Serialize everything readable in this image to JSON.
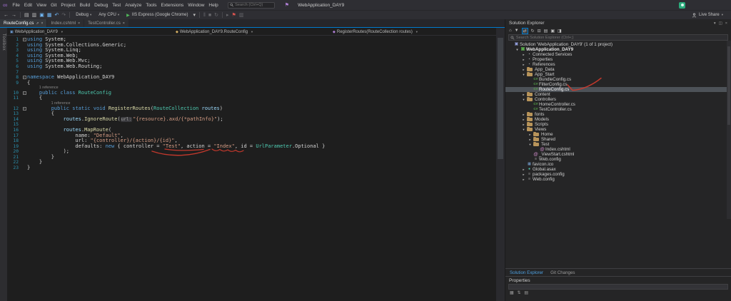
{
  "colors": {
    "accent_blue": "#007acc",
    "editor_bg": "#1e1e1e",
    "chrome_bg": "#2e2e33",
    "red_pen": "#d23b2e",
    "selection": "#4d5258"
  },
  "toolbox_label": "Toolbox",
  "title_bar": {
    "menus": [
      "File",
      "Edit",
      "View",
      "Git",
      "Project",
      "Build",
      "Debug",
      "Test",
      "Analyze",
      "Tools",
      "Extensions",
      "Window",
      "Help"
    ],
    "search": {
      "placeholder": "Search (Ctrl+Q)"
    },
    "window_title": "WebApplication_DAY9"
  },
  "toolbar": {
    "items": [
      {
        "type": "icon",
        "name": "back-icon",
        "glyph": "←"
      },
      {
        "type": "icon",
        "name": "forward-icon",
        "glyph": "→"
      },
      {
        "type": "sep"
      },
      {
        "type": "icon",
        "name": "new-file-icon",
        "glyph": "▤"
      },
      {
        "type": "icon",
        "name": "open-file-icon",
        "glyph": "▥"
      },
      {
        "type": "icon",
        "name": "save-icon",
        "glyph": "▣",
        "color": "#75beff"
      },
      {
        "type": "icon",
        "name": "save-all-icon",
        "glyph": "▦",
        "color": "#75beff"
      },
      {
        "type": "icon",
        "name": "undo-icon",
        "glyph": "↶",
        "color": "#75beff"
      },
      {
        "type": "icon",
        "name": "redo-icon",
        "glyph": "↷",
        "dim": true
      },
      {
        "type": "sep"
      },
      {
        "type": "dropdown",
        "name": "configuration-dropdown",
        "label": "Debug"
      },
      {
        "type": "dropdown",
        "name": "platform-dropdown",
        "label": "Any CPU"
      },
      {
        "type": "run",
        "name": "start-debug-button",
        "label": "IIS Express (Google Chrome)"
      },
      {
        "type": "icon",
        "name": "run-options-chevron-icon",
        "glyph": "▾"
      },
      {
        "type": "sep"
      },
      {
        "type": "icon",
        "name": "pause-icon",
        "glyph": "‖",
        "dim": true
      },
      {
        "type": "icon",
        "name": "stop-icon",
        "glyph": "■",
        "dim": true
      },
      {
        "type": "icon",
        "name": "restart-icon",
        "glyph": "↻",
        "dim": true
      },
      {
        "type": "sep"
      },
      {
        "type": "icon",
        "name": "find-in-files-icon",
        "glyph": "▸",
        "dim": true
      },
      {
        "type": "icon",
        "name": "feedback-flag-icon",
        "glyph": "⚑",
        "color": "#d9534f"
      },
      {
        "type": "icon",
        "name": "chart-icon",
        "glyph": "▥",
        "dim": true
      }
    ],
    "live_share": {
      "label": "Live Share"
    }
  },
  "tabs": [
    {
      "label": "RouteConfig.cs",
      "active": true
    },
    {
      "label": "Index.cshtml",
      "active": false
    },
    {
      "label": "TestController.cs",
      "active": false
    }
  ],
  "breadcrumb": {
    "segments": [
      {
        "label": "WebApplication_DAY9"
      },
      {
        "label": "WebApplication_DAY9.RouteConfig"
      },
      {
        "label": "RegisterRoutes(RouteCollection routes)"
      }
    ]
  },
  "editor": {
    "lines": [
      {
        "n": 1,
        "fold": true,
        "tokens": [
          [
            "k",
            "using"
          ],
          [
            "pl",
            " System;"
          ]
        ]
      },
      {
        "n": 2,
        "tokens": [
          [
            "k",
            "using"
          ],
          [
            "pl",
            " System.Collections.Generic;"
          ]
        ]
      },
      {
        "n": 3,
        "tokens": [
          [
            "k",
            "using"
          ],
          [
            "pl",
            " System.Linq;"
          ]
        ]
      },
      {
        "n": 4,
        "tokens": [
          [
            "k",
            "using"
          ],
          [
            "pl",
            " System.Web;"
          ]
        ]
      },
      {
        "n": 5,
        "tokens": [
          [
            "k",
            "using"
          ],
          [
            "pl",
            " System.Web.Mvc;"
          ]
        ]
      },
      {
        "n": 6,
        "tokens": [
          [
            "k",
            "using"
          ],
          [
            "pl",
            " System.Web.Routing;"
          ]
        ]
      },
      {
        "n": 7,
        "tokens": []
      },
      {
        "n": 8,
        "fold": true,
        "tokens": [
          [
            "k",
            "namespace"
          ],
          [
            "pl",
            " WebApplication_DAY9"
          ]
        ]
      },
      {
        "n": 9,
        "tokens": [
          [
            "pl",
            "{"
          ]
        ]
      },
      {
        "n": 10,
        "fold": true,
        "codelens": "1 reference",
        "codelens_indent": 4,
        "tokens": [
          [
            "pl",
            "    "
          ],
          [
            "k",
            "public"
          ],
          [
            "pl",
            " "
          ],
          [
            "k",
            "class"
          ],
          [
            "ty",
            " RouteConfig"
          ]
        ]
      },
      {
        "n": 11,
        "tokens": [
          [
            "pl",
            "    {"
          ]
        ]
      },
      {
        "n": 12,
        "fold": true,
        "codelens": "1 reference",
        "codelens_indent": 8,
        "tokens": [
          [
            "pl",
            "        "
          ],
          [
            "k",
            "public"
          ],
          [
            "pl",
            " "
          ],
          [
            "k",
            "static"
          ],
          [
            "pl",
            " "
          ],
          [
            "k",
            "void"
          ],
          [
            "me",
            " RegisterRoutes"
          ],
          [
            "pl",
            "("
          ],
          [
            "ty",
            "RouteCollection"
          ],
          [
            "va",
            " routes"
          ],
          [
            "pl",
            ")"
          ]
        ]
      },
      {
        "n": 13,
        "tokens": [
          [
            "pl",
            "        {"
          ]
        ]
      },
      {
        "n": 14,
        "tokens": [
          [
            "pl",
            "            "
          ],
          [
            "va",
            "routes"
          ],
          [
            "pl",
            "."
          ],
          [
            "me",
            "IgnoreRoute"
          ],
          [
            "pl",
            "("
          ],
          [
            "hint",
            "url:"
          ],
          [
            "st",
            "\"{resource}.axd/{*pathInfo}\""
          ],
          [
            "pl",
            ");"
          ]
        ]
      },
      {
        "n": 15,
        "tokens": []
      },
      {
        "n": 16,
        "tokens": [
          [
            "pl",
            "            "
          ],
          [
            "va",
            "routes"
          ],
          [
            "pl",
            "."
          ],
          [
            "me",
            "MapRoute"
          ],
          [
            "pl",
            "("
          ]
        ]
      },
      {
        "n": 17,
        "tokens": [
          [
            "pl",
            "                name: "
          ],
          [
            "st",
            "\"Default\""
          ],
          [
            "pl",
            ","
          ]
        ]
      },
      {
        "n": 18,
        "tokens": [
          [
            "pl",
            "                url: "
          ],
          [
            "st",
            "\"{controller}/{action}/{id}\""
          ],
          [
            "pl",
            ","
          ]
        ]
      },
      {
        "n": 19,
        "tokens": [
          [
            "pl",
            "                defaults: "
          ],
          [
            "k",
            "new"
          ],
          [
            "pl",
            " { controller = "
          ],
          [
            "st",
            "\"Test\""
          ],
          [
            "pl",
            ", action = "
          ],
          [
            "st",
            "\"Index\""
          ],
          [
            "pl",
            ", id = "
          ],
          [
            "ty",
            "UrlParameter"
          ],
          [
            "pl",
            ".Optional }"
          ]
        ]
      },
      {
        "n": 20,
        "tokens": [
          [
            "pl",
            "            );"
          ]
        ]
      },
      {
        "n": 21,
        "tokens": [
          [
            "pl",
            "        }"
          ]
        ]
      },
      {
        "n": 22,
        "tokens": [
          [
            "pl",
            "    }"
          ]
        ]
      },
      {
        "n": 23,
        "tokens": [
          [
            "pl",
            "}"
          ]
        ]
      }
    ]
  },
  "solution_explorer": {
    "title": "Solution Explorer",
    "header_icons": [
      {
        "name": "chevron-down-icon",
        "glyph": "▾"
      },
      {
        "name": "maximize-icon",
        "glyph": "◫"
      },
      {
        "name": "close-icon",
        "glyph": "×"
      }
    ],
    "toolbar_icons": [
      {
        "name": "home-icon",
        "glyph": "⌂"
      },
      {
        "name": "filter-icon",
        "glyph": "▼"
      },
      {
        "name": "sync-active-document-icon",
        "glyph": "⇄",
        "boxed": true
      },
      {
        "name": "refresh-icon",
        "glyph": "↻"
      },
      {
        "name": "collapse-all-icon",
        "glyph": "⊟"
      },
      {
        "name": "show-all-files-icon",
        "glyph": "▤"
      },
      {
        "name": "properties-icon",
        "glyph": "▣"
      },
      {
        "name": "preview-icon",
        "glyph": "◨"
      }
    ],
    "search": {
      "placeholder": "Search Solution Explorer (Ctrl+;)"
    },
    "tree": [
      {
        "indent": 0,
        "arrow": "",
        "icon": "solution",
        "label": "Solution 'WebApplication_DAY9' (1 of 1 project)"
      },
      {
        "indent": 1,
        "arrow": "down",
        "icon": "project",
        "label": "WebApplication_DAY9",
        "bold": true
      },
      {
        "indent": 2,
        "arrow": "right",
        "icon": "generic",
        "label": "Connected Services"
      },
      {
        "indent": 2,
        "arrow": "right",
        "icon": "generic",
        "label": "Properties"
      },
      {
        "indent": 2,
        "arrow": "right",
        "icon": "generic",
        "label": "References"
      },
      {
        "indent": 2,
        "arrow": "right",
        "icon": "folder",
        "label": "App_Data"
      },
      {
        "indent": 2,
        "arrow": "down",
        "icon": "folder",
        "label": "App_Start"
      },
      {
        "indent": 3,
        "arrow": "",
        "icon": "cs",
        "label": "BundleConfig.cs"
      },
      {
        "indent": 3,
        "arrow": "",
        "icon": "cs",
        "label": "FilterConfig.cs"
      },
      {
        "indent": 3,
        "arrow": "",
        "icon": "cs",
        "label": "RouteConfig.cs",
        "selected": true
      },
      {
        "indent": 2,
        "arrow": "right",
        "icon": "folder",
        "label": "Content"
      },
      {
        "indent": 2,
        "arrow": "down",
        "icon": "folder",
        "label": "Controllers"
      },
      {
        "indent": 3,
        "arrow": "",
        "icon": "cs",
        "label": "HomeController.cs"
      },
      {
        "indent": 3,
        "arrow": "",
        "icon": "cs",
        "label": "TestController.cs"
      },
      {
        "indent": 2,
        "arrow": "right",
        "icon": "folder",
        "label": "fonts"
      },
      {
        "indent": 2,
        "arrow": "right",
        "icon": "folder",
        "label": "Models"
      },
      {
        "indent": 2,
        "arrow": "right",
        "icon": "folder",
        "label": "Scripts"
      },
      {
        "indent": 2,
        "arrow": "down",
        "icon": "folder",
        "label": "Views"
      },
      {
        "indent": 3,
        "arrow": "right",
        "icon": "folder",
        "label": "Home"
      },
      {
        "indent": 3,
        "arrow": "right",
        "icon": "folder",
        "label": "Shared"
      },
      {
        "indent": 3,
        "arrow": "down",
        "icon": "folder",
        "label": "Test"
      },
      {
        "indent": 4,
        "arrow": "",
        "icon": "razor",
        "label": "Index.cshtml"
      },
      {
        "indent": 3,
        "arrow": "",
        "icon": "razor",
        "label": "_ViewStart.cshtml"
      },
      {
        "indent": 3,
        "arrow": "",
        "icon": "config",
        "label": "Web.config"
      },
      {
        "indent": 2,
        "arrow": "",
        "icon": "img",
        "label": "favicon.ico"
      },
      {
        "indent": 2,
        "arrow": "right",
        "icon": "globe",
        "label": "Global.asax"
      },
      {
        "indent": 2,
        "arrow": "right",
        "icon": "config",
        "label": "packages.config"
      },
      {
        "indent": 2,
        "arrow": "right",
        "icon": "config",
        "label": "Web.config"
      }
    ]
  },
  "panel_tabs": [
    {
      "label": "Solution Explorer",
      "active": true
    },
    {
      "label": "Git Changes",
      "active": false
    }
  ],
  "properties_panel": {
    "title": "Properties",
    "toolbar_icons": [
      {
        "name": "categorized-icon",
        "glyph": "▦"
      },
      {
        "name": "alphabetical-icon",
        "glyph": "⇅"
      },
      {
        "name": "property-pages-icon",
        "glyph": "▤"
      }
    ]
  },
  "annotations": {
    "pen_color": "#d23b2e",
    "marks": [
      "underline-test",
      "underline-index",
      "swoosh-defaults",
      "check-routeconfig-file"
    ]
  }
}
